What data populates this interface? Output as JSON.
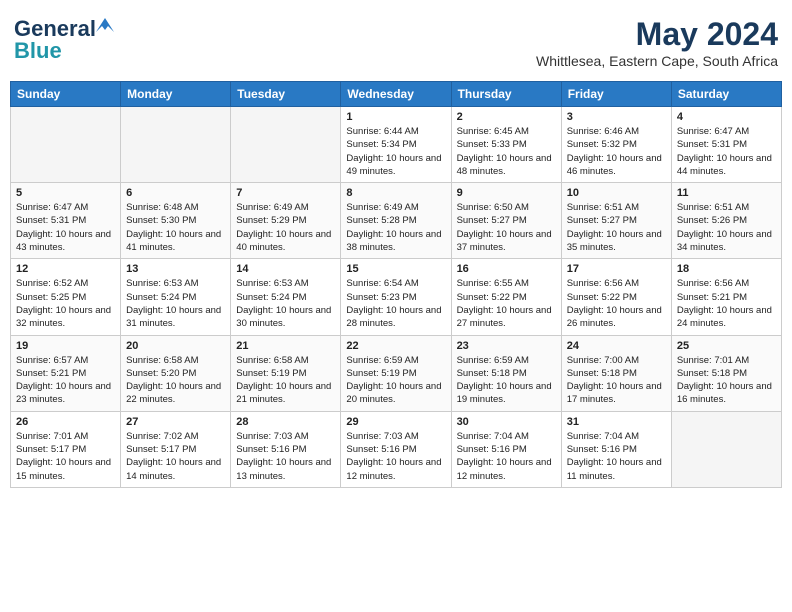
{
  "header": {
    "logo_line1": "General",
    "logo_line2": "Blue",
    "title": "May 2024",
    "subtitle": "Whittlesea, Eastern Cape, South Africa"
  },
  "columns": [
    "Sunday",
    "Monday",
    "Tuesday",
    "Wednesday",
    "Thursday",
    "Friday",
    "Saturday"
  ],
  "weeks": [
    [
      {
        "day": "",
        "info": ""
      },
      {
        "day": "",
        "info": ""
      },
      {
        "day": "",
        "info": ""
      },
      {
        "day": "1",
        "info": "Sunrise: 6:44 AM\nSunset: 5:34 PM\nDaylight: 10 hours and 49 minutes."
      },
      {
        "day": "2",
        "info": "Sunrise: 6:45 AM\nSunset: 5:33 PM\nDaylight: 10 hours and 48 minutes."
      },
      {
        "day": "3",
        "info": "Sunrise: 6:46 AM\nSunset: 5:32 PM\nDaylight: 10 hours and 46 minutes."
      },
      {
        "day": "4",
        "info": "Sunrise: 6:47 AM\nSunset: 5:31 PM\nDaylight: 10 hours and 44 minutes."
      }
    ],
    [
      {
        "day": "5",
        "info": "Sunrise: 6:47 AM\nSunset: 5:31 PM\nDaylight: 10 hours and 43 minutes."
      },
      {
        "day": "6",
        "info": "Sunrise: 6:48 AM\nSunset: 5:30 PM\nDaylight: 10 hours and 41 minutes."
      },
      {
        "day": "7",
        "info": "Sunrise: 6:49 AM\nSunset: 5:29 PM\nDaylight: 10 hours and 40 minutes."
      },
      {
        "day": "8",
        "info": "Sunrise: 6:49 AM\nSunset: 5:28 PM\nDaylight: 10 hours and 38 minutes."
      },
      {
        "day": "9",
        "info": "Sunrise: 6:50 AM\nSunset: 5:27 PM\nDaylight: 10 hours and 37 minutes."
      },
      {
        "day": "10",
        "info": "Sunrise: 6:51 AM\nSunset: 5:27 PM\nDaylight: 10 hours and 35 minutes."
      },
      {
        "day": "11",
        "info": "Sunrise: 6:51 AM\nSunset: 5:26 PM\nDaylight: 10 hours and 34 minutes."
      }
    ],
    [
      {
        "day": "12",
        "info": "Sunrise: 6:52 AM\nSunset: 5:25 PM\nDaylight: 10 hours and 32 minutes."
      },
      {
        "day": "13",
        "info": "Sunrise: 6:53 AM\nSunset: 5:24 PM\nDaylight: 10 hours and 31 minutes."
      },
      {
        "day": "14",
        "info": "Sunrise: 6:53 AM\nSunset: 5:24 PM\nDaylight: 10 hours and 30 minutes."
      },
      {
        "day": "15",
        "info": "Sunrise: 6:54 AM\nSunset: 5:23 PM\nDaylight: 10 hours and 28 minutes."
      },
      {
        "day": "16",
        "info": "Sunrise: 6:55 AM\nSunset: 5:22 PM\nDaylight: 10 hours and 27 minutes."
      },
      {
        "day": "17",
        "info": "Sunrise: 6:56 AM\nSunset: 5:22 PM\nDaylight: 10 hours and 26 minutes."
      },
      {
        "day": "18",
        "info": "Sunrise: 6:56 AM\nSunset: 5:21 PM\nDaylight: 10 hours and 24 minutes."
      }
    ],
    [
      {
        "day": "19",
        "info": "Sunrise: 6:57 AM\nSunset: 5:21 PM\nDaylight: 10 hours and 23 minutes."
      },
      {
        "day": "20",
        "info": "Sunrise: 6:58 AM\nSunset: 5:20 PM\nDaylight: 10 hours and 22 minutes."
      },
      {
        "day": "21",
        "info": "Sunrise: 6:58 AM\nSunset: 5:19 PM\nDaylight: 10 hours and 21 minutes."
      },
      {
        "day": "22",
        "info": "Sunrise: 6:59 AM\nSunset: 5:19 PM\nDaylight: 10 hours and 20 minutes."
      },
      {
        "day": "23",
        "info": "Sunrise: 6:59 AM\nSunset: 5:18 PM\nDaylight: 10 hours and 19 minutes."
      },
      {
        "day": "24",
        "info": "Sunrise: 7:00 AM\nSunset: 5:18 PM\nDaylight: 10 hours and 17 minutes."
      },
      {
        "day": "25",
        "info": "Sunrise: 7:01 AM\nSunset: 5:18 PM\nDaylight: 10 hours and 16 minutes."
      }
    ],
    [
      {
        "day": "26",
        "info": "Sunrise: 7:01 AM\nSunset: 5:17 PM\nDaylight: 10 hours and 15 minutes."
      },
      {
        "day": "27",
        "info": "Sunrise: 7:02 AM\nSunset: 5:17 PM\nDaylight: 10 hours and 14 minutes."
      },
      {
        "day": "28",
        "info": "Sunrise: 7:03 AM\nSunset: 5:16 PM\nDaylight: 10 hours and 13 minutes."
      },
      {
        "day": "29",
        "info": "Sunrise: 7:03 AM\nSunset: 5:16 PM\nDaylight: 10 hours and 12 minutes."
      },
      {
        "day": "30",
        "info": "Sunrise: 7:04 AM\nSunset: 5:16 PM\nDaylight: 10 hours and 12 minutes."
      },
      {
        "day": "31",
        "info": "Sunrise: 7:04 AM\nSunset: 5:16 PM\nDaylight: 10 hours and 11 minutes."
      },
      {
        "day": "",
        "info": ""
      }
    ]
  ]
}
